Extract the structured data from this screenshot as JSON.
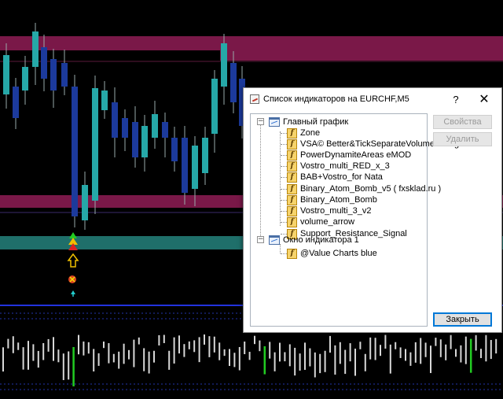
{
  "dialog": {
    "title": "Список индикаторов на EURCHF,M5",
    "help_label": "?",
    "close_label": "✕",
    "properties_label": "Свойства",
    "delete_label": "Удалить",
    "close_button_label": "Закрыть",
    "accent_color": "#0078d7",
    "tree": {
      "main": {
        "label": "Главный график",
        "expander": "−",
        "items": [
          "Zone",
          "VSA© Better&TickSeparateVolumeHistogram",
          "PowerDynamiteAreas eMOD",
          "Vostro_multi_RED_x_3",
          "BAB+Vostro_for Nata",
          "Binary_Atom_Bomb_v5 ( fxsklad.ru )",
          "Binary_Atom_Bomb",
          "Vostro_multi_3_v2",
          "volume_arrow",
          "Support_Resistance_Signal"
        ]
      },
      "sub": {
        "label": "Окно индикатора 1",
        "expander": "−",
        "items": [
          "@Value Charts blue"
        ]
      }
    }
  },
  "chart": {
    "background": "#000000",
    "resistance_band_color": "#7a1848",
    "support_band_color": "#1f6f6a",
    "bull_candle_color": "#26a8a8",
    "bear_candle_color": "#1c3a9c",
    "separator_color": "#2233dd",
    "volume_color": "#d8d8d8",
    "volume_signal_color": "#22cc22"
  }
}
